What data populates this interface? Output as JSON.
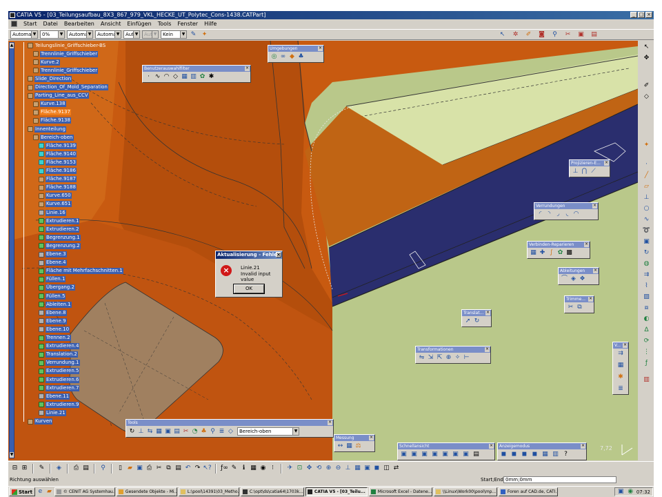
{
  "window": {
    "title": "CATIA V5 - [03_Teilungsaufbau_8X3_867_979_VKL_HECKE_UT_Polytec_Cons-1438.CATPart]"
  },
  "menu": [
    "Start",
    "Datei",
    "Bearbeiten",
    "Ansicht",
    "Einfügen",
    "Tools",
    "Fenster",
    "Hilfe"
  ],
  "toolbar": {
    "combos": [
      "Automa",
      "0%",
      "Automa",
      "Automa",
      "Aut",
      "Aut",
      "Kein"
    ]
  },
  "tree": {
    "items": [
      {
        "label": "Teilungslinie_Griffschieber-BS",
        "style": "plain",
        "icon": "geo"
      },
      {
        "label": "Trennlinie_Griffschieber",
        "style": "blue",
        "icon": "geo"
      },
      {
        "label": "Kurve.2",
        "style": "blue",
        "icon": "geo"
      },
      {
        "label": "Trennlinie_Griffschieber",
        "style": "blue",
        "icon": "geo"
      },
      {
        "label": "Slide_Direction",
        "style": "blue",
        "icon": "geo"
      },
      {
        "label": "Direction_Of_Mold_Separation",
        "style": "blue",
        "icon": "geo"
      },
      {
        "label": "Parting_Line_aus_CCV",
        "style": "blue",
        "icon": "geo"
      },
      {
        "label": "Kurve.138",
        "style": "blue",
        "icon": "geo"
      },
      {
        "label": "Fläche.9137",
        "style": "sel",
        "icon": "geo"
      },
      {
        "label": "Fläche.9138",
        "style": "blue",
        "icon": "geo"
      },
      {
        "label": "Innenteilung",
        "style": "blue",
        "icon": "geo"
      },
      {
        "label": "Bereich-oben",
        "style": "blue",
        "icon": "geo"
      },
      {
        "label": "Fläche.9139",
        "style": "blue",
        "icon": "cyan"
      },
      {
        "label": "Fläche.9140",
        "style": "blue",
        "icon": "cyan"
      },
      {
        "label": "Fläche.9153",
        "style": "blue",
        "icon": "cyan"
      },
      {
        "label": "Fläche.9186",
        "style": "blue",
        "icon": "cyan"
      },
      {
        "label": "Fläche.9187",
        "style": "blue",
        "icon": "geo"
      },
      {
        "label": "Fläche.9188",
        "style": "blue",
        "icon": "geo"
      },
      {
        "label": "Kurve.650",
        "style": "blue",
        "icon": "geo"
      },
      {
        "label": "Kurve.651",
        "style": "blue",
        "icon": "geo"
      },
      {
        "label": "Linie.16",
        "style": "blue",
        "icon": "gry"
      },
      {
        "label": "Extrudieren.1",
        "style": "blue",
        "icon": "grn"
      },
      {
        "label": "Extrudieren.2",
        "style": "blue",
        "icon": "grn"
      },
      {
        "label": "Begrenzung.1",
        "style": "blue",
        "icon": "grn"
      },
      {
        "label": "Begrenzung.2",
        "style": "blue",
        "icon": "grn"
      },
      {
        "label": "Ebene.3",
        "style": "blue",
        "icon": "gry"
      },
      {
        "label": "Ebene.4",
        "style": "blue",
        "icon": "gry"
      },
      {
        "label": "Fläche mit Mehrfachschnitten.1",
        "style": "blue",
        "icon": "grn"
      },
      {
        "label": "Füllen.1",
        "style": "blue",
        "icon": "grn"
      },
      {
        "label": "Übergang.2",
        "style": "blue",
        "icon": "grn"
      },
      {
        "label": "Füllen.5",
        "style": "blue",
        "icon": "grn"
      },
      {
        "label": "Ableiten.1",
        "style": "blue",
        "icon": "grn"
      },
      {
        "label": "Ebene.8",
        "style": "blue",
        "icon": "gry"
      },
      {
        "label": "Ebene.9",
        "style": "blue",
        "icon": "gry"
      },
      {
        "label": "Ebene.10",
        "style": "blue",
        "icon": "gry"
      },
      {
        "label": "Trennen.2",
        "style": "blue",
        "icon": "grn"
      },
      {
        "label": "Extrudieren.4",
        "style": "blue",
        "icon": "grn"
      },
      {
        "label": "Translation.2",
        "style": "blue",
        "icon": "grn"
      },
      {
        "label": "Verrundung.1",
        "style": "blue",
        "icon": "grn"
      },
      {
        "label": "Extrudieren.5",
        "style": "blue",
        "icon": "grn"
      },
      {
        "label": "Extrudieren.6",
        "style": "blue",
        "icon": "grn"
      },
      {
        "label": "Extrudieren.7",
        "style": "blue",
        "icon": "grn"
      },
      {
        "label": "Ebene.11",
        "style": "blue",
        "icon": "gry"
      },
      {
        "label": "Extrudieren.9",
        "style": "blue",
        "icon": "grn"
      },
      {
        "label": "Linie.21",
        "style": "blue",
        "icon": "gry"
      },
      {
        "label": "Kurven",
        "style": "blue",
        "icon": "geo"
      }
    ]
  },
  "floating_toolbars": {
    "umgebungen": "Umgebungen",
    "benutzerauswahlfilter": "Benutzerauswahlfilter",
    "projizieren": "Projizieren-E...",
    "verrundungen": "Verrundungen",
    "verbinden": "Verbinden-Reparieren",
    "ableitungen": "Ableitungen",
    "trimmen": "Trimme...",
    "translat": "Translat...",
    "transformationen": "Transformationen",
    "v": "V...",
    "tools": "Tools",
    "tools_combo": "Bereich-oben",
    "messung": "Messung",
    "schnellansicht": "Schnellansicht",
    "anzeigemodus": "Anzeigemodus"
  },
  "dialog": {
    "title": "Aktualisierung - Fehler",
    "line1": "Linie.21",
    "line2": "Invalid input value",
    "ok": "OK"
  },
  "viewport": {
    "scale_label": "7,72"
  },
  "status": {
    "left": "Richtung auswählen",
    "right": "Start;Ende",
    "input": "0mm;0mm"
  },
  "taskbar": {
    "start": "Start",
    "tasks": [
      {
        "label": "© CENIT AG Systemhau...",
        "active": false
      },
      {
        "label": "Gesendete Objekte - Mi...",
        "active": false
      },
      {
        "label": "L:\\pool\\14391\\03_Metho...",
        "active": false
      },
      {
        "label": "C:\\opt\\ds\\catia64\\1703k...",
        "active": false
      },
      {
        "label": "CATIA V5 - [03_Teilu...",
        "active": true
      },
      {
        "label": "Microsoft Excel - Datene...",
        "active": false
      },
      {
        "label": "\\\\Linux\\Work00\\pool\\mp...",
        "active": false
      },
      {
        "label": "Foren auf CAD.de, CATI...",
        "active": false
      }
    ],
    "clock": "07:32"
  },
  "colors": {
    "orange": "#c85a10",
    "olive": "#b9c88a",
    "navy": "#2a2e6e",
    "pale": "#d8e2a8",
    "tan": "#a08060"
  }
}
